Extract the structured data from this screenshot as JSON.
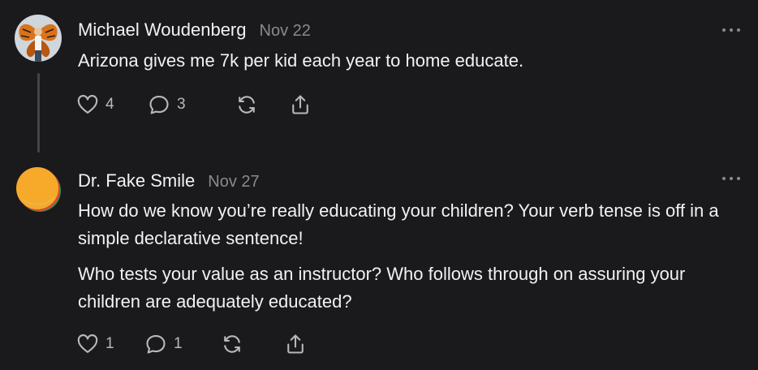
{
  "posts": [
    {
      "author": "Michael Woudenberg",
      "date": "Nov 22",
      "paragraphs": [
        "Arizona gives me 7k per kid each year to home educate."
      ],
      "likes": "4",
      "comments": "3"
    },
    {
      "author": "Dr. Fake Smile",
      "date": "Nov 27",
      "paragraphs": [
        "How do we know you’re really educating your children? Your verb tense is off in a simple declarative sentence!",
        "Who tests your value as an instructor? Who follows through on assuring your children are adequately educated?"
      ],
      "likes": "1",
      "comments": "1"
    }
  ],
  "colors": {
    "background": "#1a1a1c",
    "text": "#f2f2f2",
    "muted": "#8a8a8e",
    "thread_line": "#444448"
  },
  "icons": [
    "heart-icon",
    "comment-icon",
    "restack-icon",
    "share-icon",
    "more-icon"
  ]
}
